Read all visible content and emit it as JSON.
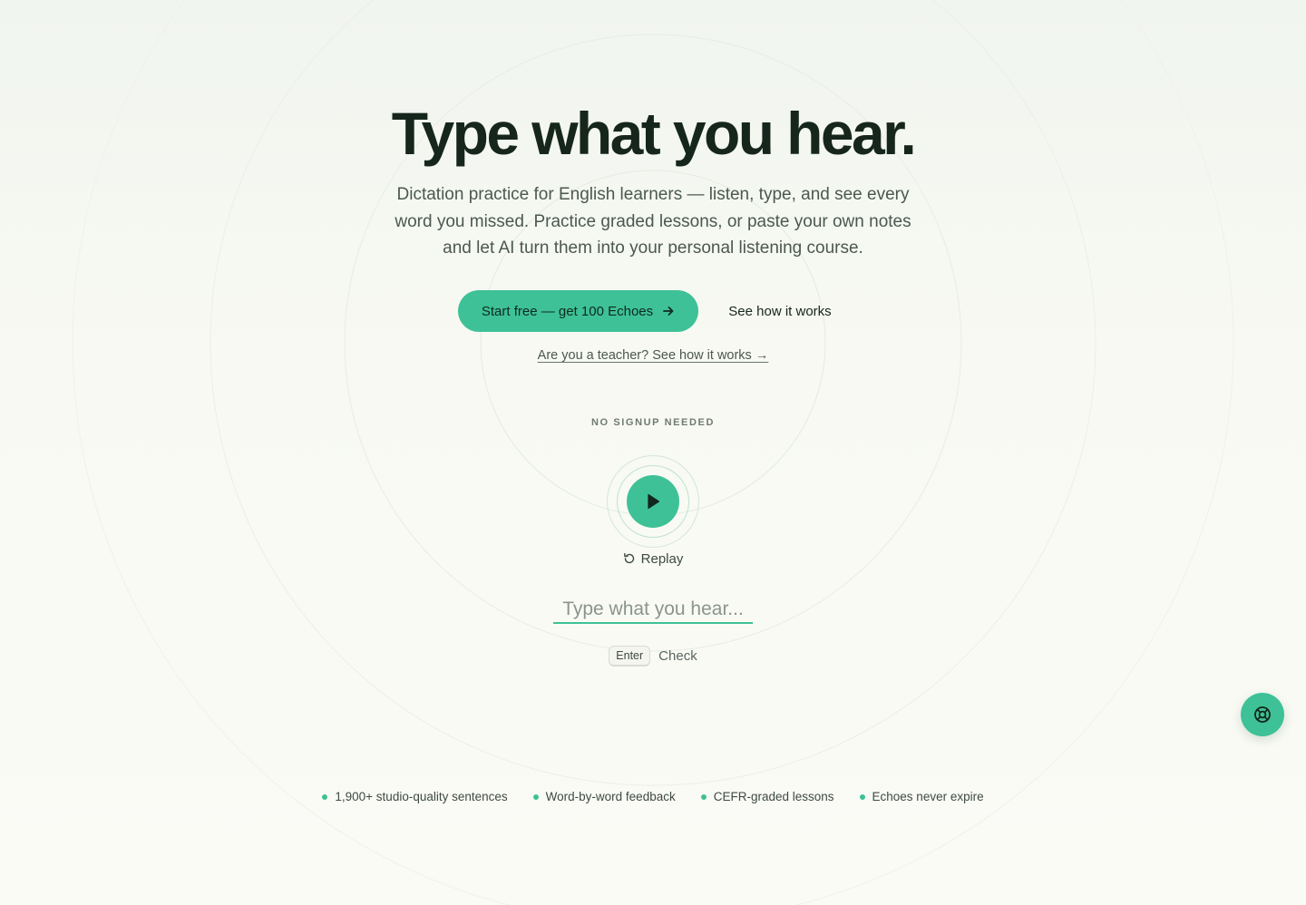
{
  "hero": {
    "title": "Type what you hear.",
    "subtitle": "Dictation practice for English learners — listen, type, and see every word you missed. Practice graded lessons, or paste your own notes and let AI turn them into your personal listening course.",
    "primary_cta": "Start free — get 100 Echoes",
    "secondary_cta": "See how it works",
    "teacher_link": "Are you a teacher? See how it works →"
  },
  "demo": {
    "label": "NO SIGNUP NEEDED",
    "play_icon": "play-icon",
    "replay_label": "Replay",
    "replay_icon": "rotate-ccw-icon",
    "input_placeholder": "Type what you hear...",
    "input_value": "",
    "key_hint": "Enter",
    "key_action": "Check"
  },
  "help_button": {
    "icon": "lifebuoy-icon"
  },
  "features": [
    "1,900+ studio-quality sentences",
    "Word-by-word feedback",
    "CEFR-graded lessons",
    "Echoes never expire"
  ],
  "colors": {
    "accent": "#3ec196",
    "text_dark": "#16261d",
    "text_muted": "#4b5850",
    "background": "#f8f9f3"
  }
}
